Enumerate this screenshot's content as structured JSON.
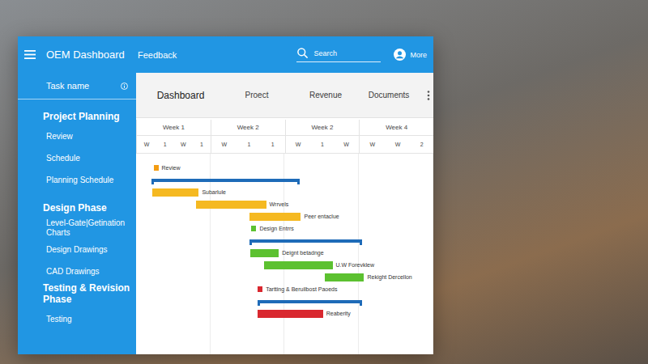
{
  "window": {
    "title": "OEM Dashboard"
  },
  "header": {
    "feedback": "Feedback",
    "search": {
      "placeholder": "Search"
    },
    "user": "More"
  },
  "sidebar": {
    "heading": "Task name",
    "groups": [
      {
        "title": "Project Planning",
        "items": [
          "Review",
          "Schedule",
          "Planning Schedule"
        ]
      },
      {
        "title": "Design Phase",
        "items": [
          "Level-Gate|Getination Charts",
          "Design Drawings",
          "CAD Drawings"
        ]
      },
      {
        "title": "Testing & Revision Phase",
        "items": [
          "Testing"
        ]
      }
    ]
  },
  "tabs": [
    {
      "label": "Dashboard",
      "selected": true
    },
    {
      "label": "Proect",
      "selected": false
    },
    {
      "label": "Revenue",
      "selected": false
    },
    {
      "label": "Documents",
      "selected": false
    }
  ],
  "gantt": {
    "weeks": [
      {
        "label": "Week 1",
        "days": [
          "W",
          "1",
          "W",
          "1"
        ]
      },
      {
        "label": "Week 2",
        "days": [
          "W",
          "1",
          "1"
        ]
      },
      {
        "label": "Week 2",
        "days": [
          "W",
          "1",
          "W"
        ]
      },
      {
        "label": "Week 4",
        "days": [
          "W",
          "W",
          "2"
        ]
      }
    ],
    "rows": [
      {
        "kind": "marker",
        "label": "Review",
        "start": 1.5,
        "color": "#f39c12"
      },
      {
        "kind": "summary",
        "start": 1.3,
        "end": 15.4,
        "color": "#1e6bb8"
      },
      {
        "kind": "bar",
        "label": "Subarlule",
        "start": 1.4,
        "end": 5.8,
        "color": "#f5b921"
      },
      {
        "kind": "bar",
        "label": "Wrrvels",
        "start": 5.5,
        "end": 12.2,
        "color": "#f5b921"
      },
      {
        "kind": "bar",
        "label": "Peer entaclue",
        "start": 10.6,
        "end": 15.5,
        "color": "#f5b921"
      },
      {
        "kind": "marker",
        "label": "Design Entrrs",
        "start": 10.8,
        "color": "#5cc130"
      },
      {
        "kind": "summary",
        "start": 10.6,
        "end": 21.3,
        "color": "#1e6bb8"
      },
      {
        "kind": "bar",
        "label": "Deignt betadnge",
        "start": 10.7,
        "end": 13.4,
        "color": "#5cc130"
      },
      {
        "kind": "bar",
        "label": "U.W Forevklew",
        "start": 12.0,
        "end": 18.5,
        "color": "#5cc130"
      },
      {
        "kind": "bar",
        "label": "Rekight Dercellon",
        "start": 17.8,
        "end": 21.5,
        "color": "#5cc130"
      },
      {
        "kind": "marker",
        "label": "Tartting & Beruilbost Paoeds",
        "start": 11.4,
        "color": "#d9282f"
      },
      {
        "kind": "summary",
        "start": 11.4,
        "end": 21.3,
        "color": "#1e6bb8"
      },
      {
        "kind": "bar",
        "label": "Reaberity",
        "start": 11.4,
        "end": 17.6,
        "color": "#d9282f"
      }
    ]
  }
}
